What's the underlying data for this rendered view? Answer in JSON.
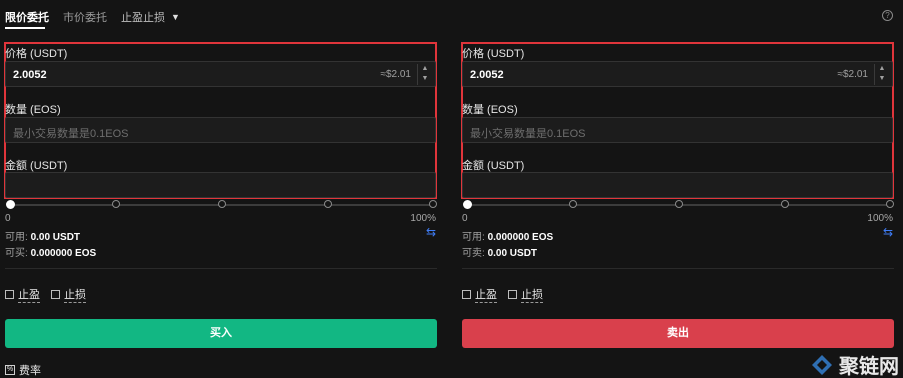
{
  "tabs": [
    {
      "label": "限价委托",
      "active": true
    },
    {
      "label": "市价委托",
      "active": false
    },
    {
      "label": "止盈止损",
      "active": false
    }
  ],
  "buy_panel": {
    "price_label": "价格 (USDT)",
    "price_value": "2.0052",
    "price_approx": "≈$2.01",
    "amount_label": "数量 (EOS)",
    "amount_placeholder": "最小交易数量是0.1EOS",
    "total_label": "金额 (USDT)",
    "slider_min": "0",
    "slider_max": "100%",
    "available_label": "可用:",
    "available_value": "0.00 USDT",
    "can_label": "可买:",
    "can_value": "0.000000 EOS",
    "take_profit": "止盈",
    "stop_loss": "止损",
    "button": "买入"
  },
  "sell_panel": {
    "price_label": "价格 (USDT)",
    "price_value": "2.0052",
    "price_approx": "≈$2.01",
    "amount_label": "数量 (EOS)",
    "amount_placeholder": "最小交易数量是0.1EOS",
    "total_label": "金额 (USDT)",
    "slider_min": "0",
    "slider_max": "100%",
    "available_label": "可用:",
    "available_value": "0.000000 EOS",
    "can_label": "可卖:",
    "can_value": "0.00 USDT",
    "take_profit": "止盈",
    "stop_loss": "止损",
    "button": "卖出"
  },
  "fee_label": "费率",
  "watermark": "聚链网",
  "colors": {
    "buy": "#12b783",
    "sell": "#d9404c",
    "highlight_box": "#e0353b",
    "swap_icon": "#3f7cf5"
  },
  "icons": {
    "help": "question-circle-icon",
    "swap": "swap-arrows-icon",
    "dropdown": "chevron-down-icon",
    "fee": "fee-icon"
  }
}
